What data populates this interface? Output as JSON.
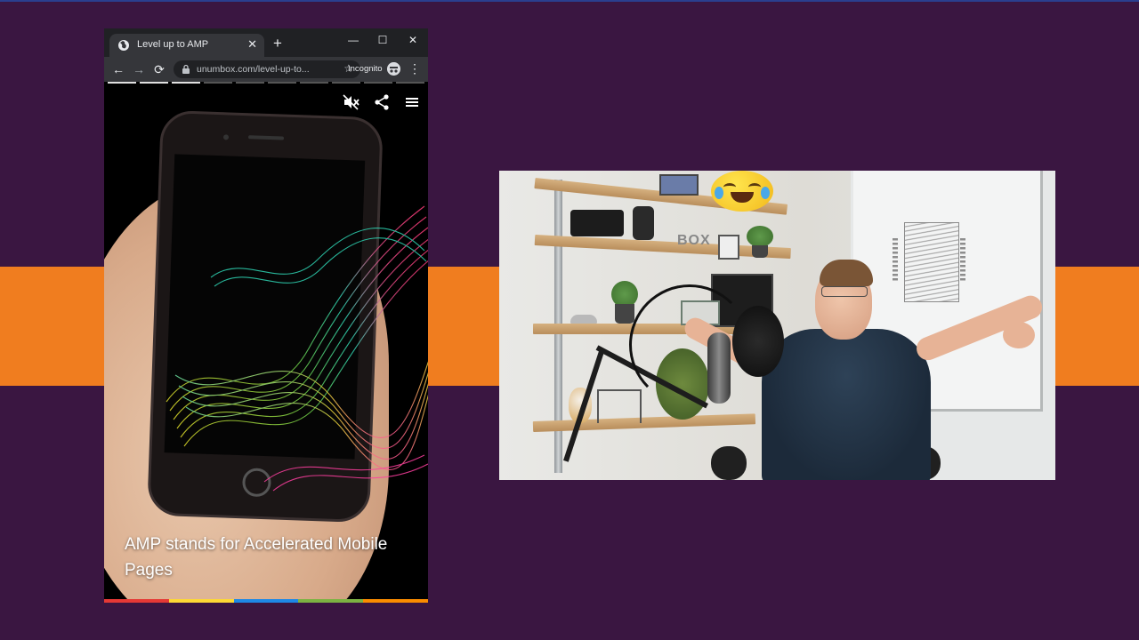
{
  "browser": {
    "tab": {
      "title": "Level up to AMP",
      "close_glyph": "✕"
    },
    "new_tab_glyph": "+",
    "window_controls": {
      "minimize": "—",
      "maximize": "☐",
      "close": "✕"
    },
    "toolbar": {
      "back_glyph": "←",
      "forward_glyph": "→",
      "reload_glyph": "⟳",
      "url": "unumbox.com/level-up-to...",
      "star_glyph": "☆",
      "incognito_label": "Incognito",
      "menu_glyph": "⋮"
    }
  },
  "story": {
    "progress_total": 10,
    "progress_completed": 3,
    "controls": [
      "mute-icon",
      "share-icon",
      "menu-icon"
    ],
    "caption": "AMP stands for Accelerated Mobile Pages",
    "color_bar": [
      "#e53935",
      "#fdd835",
      "#1e88e5",
      "#7cb342",
      "#fb8c00"
    ]
  },
  "webcam": {
    "shelf_sign": "BOX"
  },
  "colors": {
    "background": "#3a1641",
    "band": "#f07d1f",
    "chrome_titlebar": "#202124",
    "chrome_toolbar": "#35363a"
  }
}
